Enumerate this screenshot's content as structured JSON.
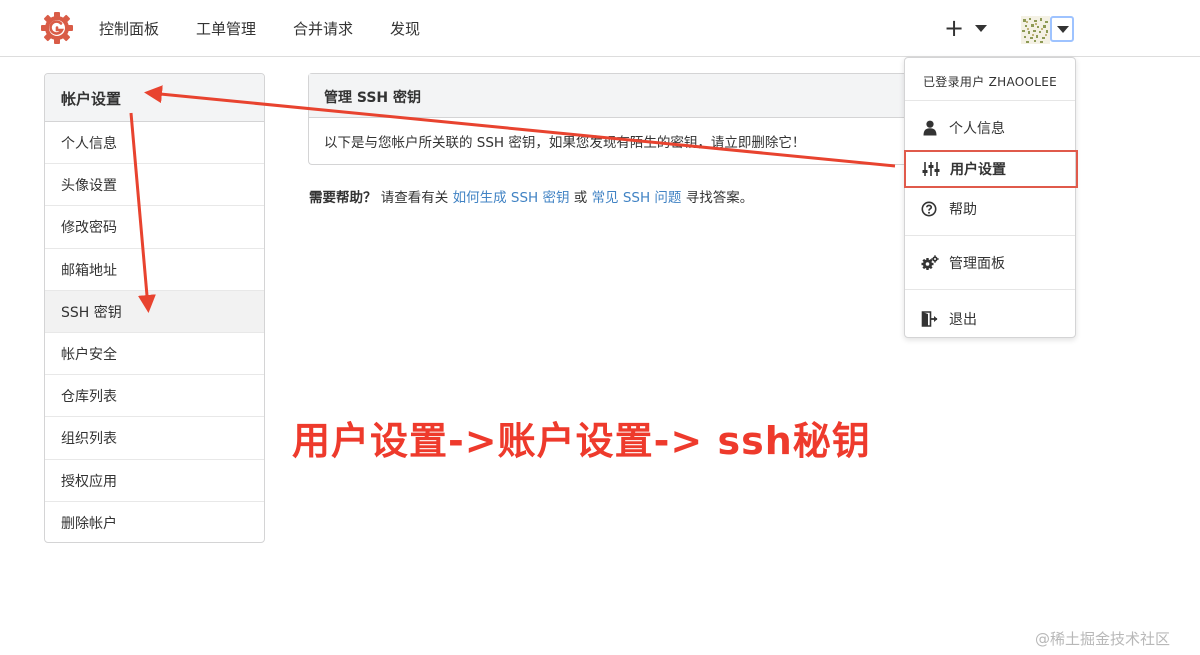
{
  "nav": {
    "items": [
      "控制面板",
      "工单管理",
      "合并请求",
      "发现"
    ],
    "plus_label": "+"
  },
  "sidebar": {
    "header": "帐户设置",
    "items": [
      {
        "label": "个人信息"
      },
      {
        "label": "头像设置"
      },
      {
        "label": "修改密码"
      },
      {
        "label": "邮箱地址"
      },
      {
        "label": "SSH 密钥",
        "active": true
      },
      {
        "label": "帐户安全"
      },
      {
        "label": "仓库列表"
      },
      {
        "label": "组织列表"
      },
      {
        "label": "授权应用"
      },
      {
        "label": "删除帐户"
      }
    ]
  },
  "panel": {
    "title": "管理 SSH 密钥",
    "body": "以下是与您帐户所关联的 SSH 密钥，如果您发现有陌生的密钥，请立即删除它！"
  },
  "help": {
    "prefix": "需要帮助？",
    "text1": " 请查看有关 ",
    "link1": "如何生成 SSH 密钥",
    "text2": " 或 ",
    "link2": "常见 SSH 问题",
    "text3": " 寻找答案。"
  },
  "dropdown": {
    "header": "已登录用户 ZHAOOLEE",
    "items": [
      {
        "label": "个人信息",
        "icon": "user-icon"
      },
      {
        "label": "用户设置",
        "icon": "sliders-icon"
      },
      {
        "label": "帮助",
        "icon": "question-circle-icon"
      },
      {
        "label": "管理面板",
        "icon": "gears-icon"
      },
      {
        "label": "退出",
        "icon": "sign-out-icon"
      }
    ]
  },
  "annotation": "用户设置->账户设置-> ssh秘钥",
  "watermark": "@稀土掘金技术社区",
  "colors": {
    "annotation_red": "#ee3a2c",
    "link_blue": "#4183c4",
    "highlight_border": "#e05a4b",
    "logo_red": "#d95c47"
  }
}
